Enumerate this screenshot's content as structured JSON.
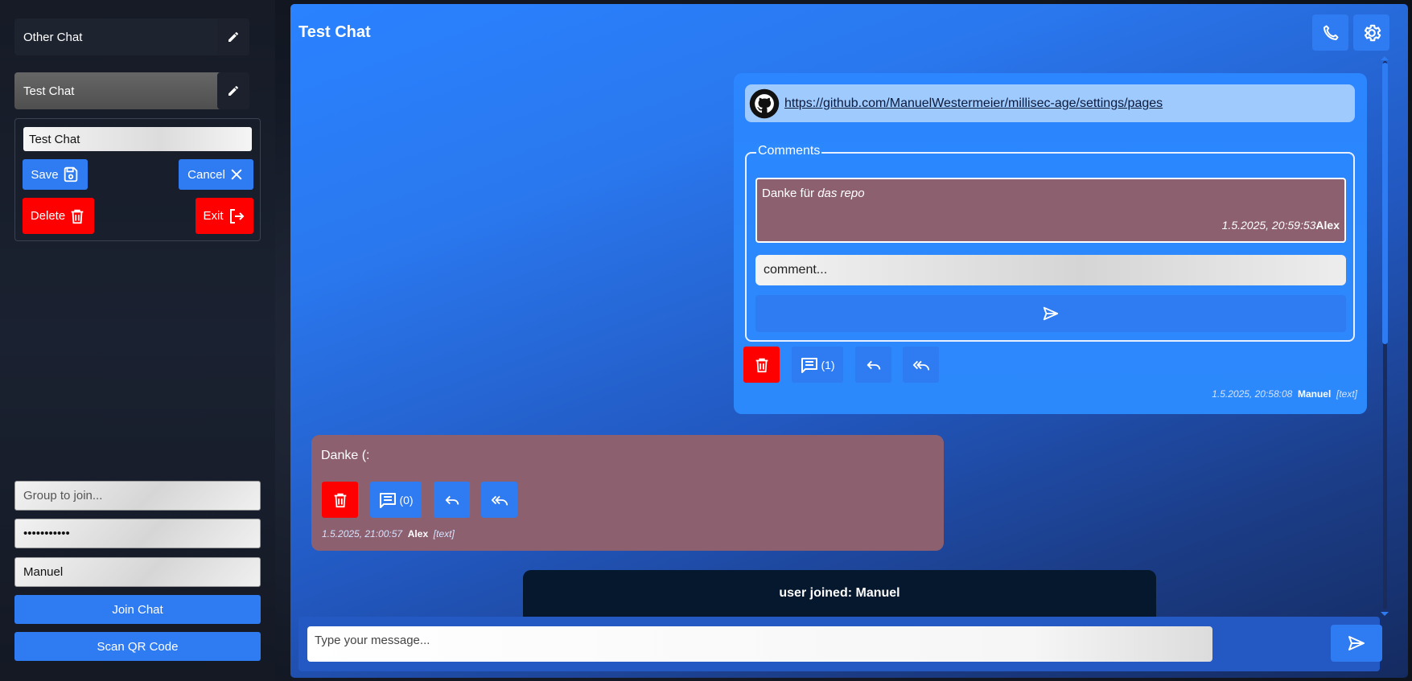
{
  "sidebar": {
    "chats": [
      {
        "label": "Other Chat",
        "active": false
      },
      {
        "label": "Test Chat",
        "active": true
      }
    ],
    "edit": {
      "name_value": "Test Chat",
      "save_label": "Save",
      "cancel_label": "Cancel",
      "delete_label": "Delete",
      "exit_label": "Exit"
    },
    "join": {
      "group_placeholder": "Group to join...",
      "password_value": "•••••••••••",
      "username_value": "Manuel",
      "join_label": "Join Chat",
      "scan_label": "Scan QR Code"
    }
  },
  "chat": {
    "title": "Test Chat",
    "icons": {
      "call": "phone-icon",
      "settings": "gear-icon"
    },
    "messages": [
      {
        "link": "https://github.com/ManuelWestermeier/millisec-age/settings/pages",
        "comments_legend": "Comments",
        "comment": {
          "text_plain": "Danke für ",
          "text_em": "das repo",
          "timestamp": "1.5.2025, 20:59:53",
          "author": "Alex"
        },
        "comment_placeholder": "comment...",
        "comment_count": "(1)",
        "timestamp": "1.5.2025, 20:58:08",
        "author": "Manuel",
        "type": "[text]"
      },
      {
        "text": "Danke (:",
        "comment_count": "(0)",
        "timestamp": "1.5.2025, 21:00:57",
        "author": "Alex",
        "type": "[text]"
      }
    ],
    "system_message": "user joined: Manuel",
    "input_placeholder": "Type your message..."
  },
  "colors": {
    "accent": "#2f7bf2",
    "danger": "#ff0000",
    "comment_bg": "#8d6070",
    "system_bg": "#05182d"
  }
}
